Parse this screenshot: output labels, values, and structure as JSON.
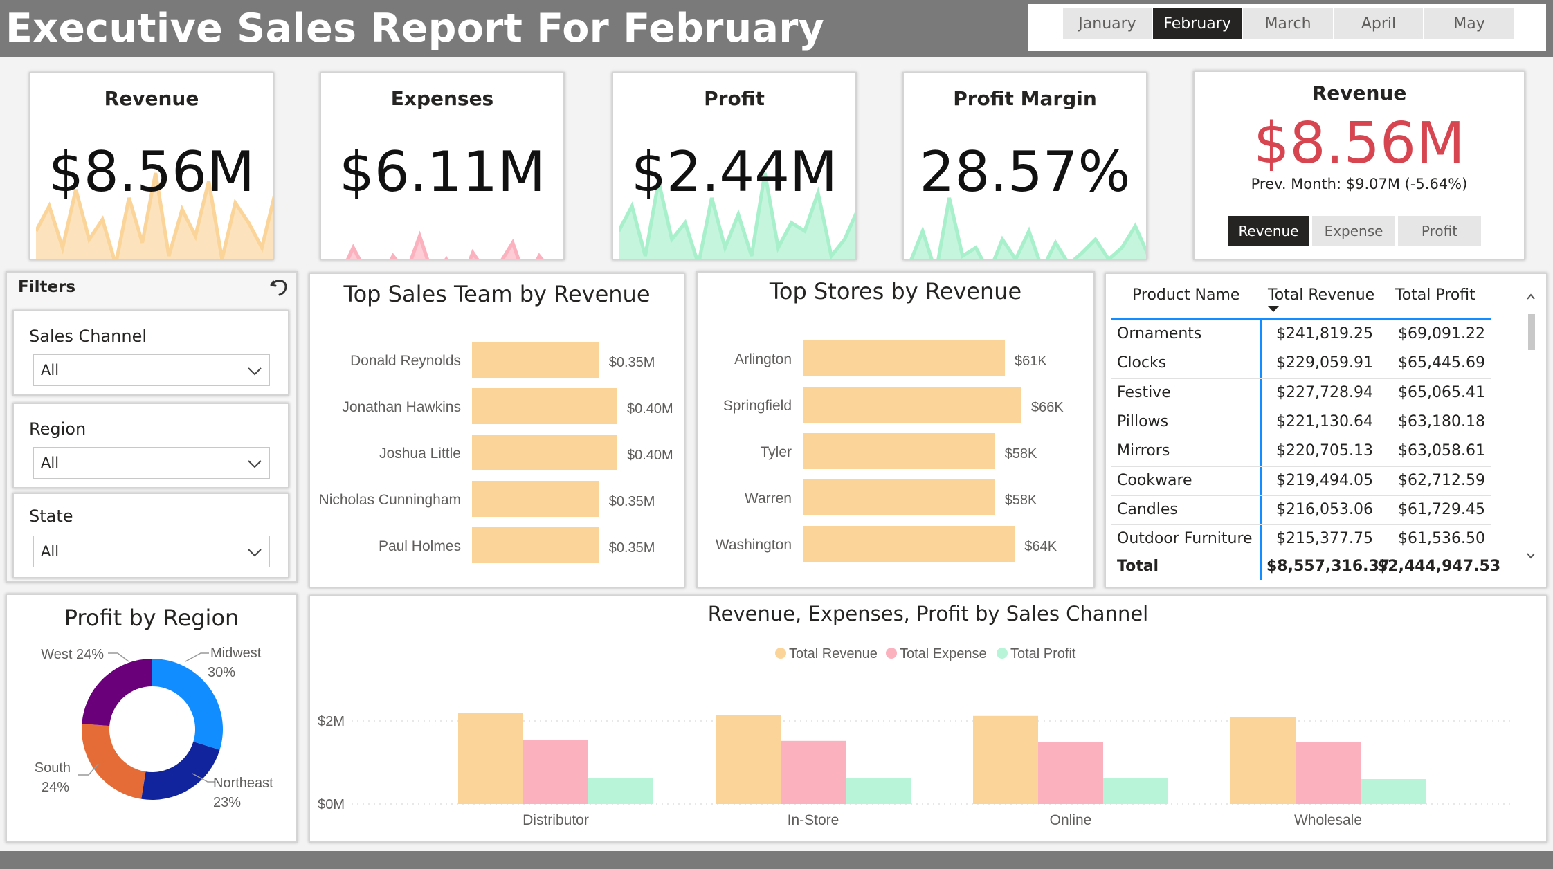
{
  "header": {
    "title": "Executive Sales Report For February",
    "months": [
      "January",
      "February",
      "March",
      "April",
      "May"
    ],
    "selected_month": "February"
  },
  "kpis": [
    {
      "title": "Revenue",
      "value": "$8.56M",
      "color": "#fbd49a"
    },
    {
      "title": "Expenses",
      "value": "$6.11M",
      "color": "#fcb1bf"
    },
    {
      "title": "Profit",
      "value": "$2.44M",
      "color": "#a8f0cb"
    },
    {
      "title": "Profit Margin",
      "value": "28.57%",
      "color": "#a8f0cb"
    }
  ],
  "revenue_card": {
    "title": "Revenue",
    "value": "$8.56M",
    "prev": "Prev. Month: $9.07M (-5.64%)",
    "value_color": "#d64550",
    "toggles": [
      "Revenue",
      "Expense",
      "Profit"
    ],
    "selected": "Revenue"
  },
  "filters": {
    "heading": "Filters",
    "slicers": [
      {
        "label": "Sales Channel",
        "value": "All"
      },
      {
        "label": "Region",
        "value": "All"
      },
      {
        "label": "State",
        "value": "All"
      }
    ]
  },
  "sales_team": {
    "title": "Top Sales Team by Revenue",
    "names": [
      "Donald Reynolds",
      "Jonathan Hawkins",
      "Joshua Little",
      "Nicholas Cunningham",
      "Paul Holmes"
    ],
    "labels": [
      "$0.35M",
      "$0.40M",
      "$0.40M",
      "$0.35M",
      "$0.35M"
    ]
  },
  "stores": {
    "title": "Top Stores by Revenue",
    "names": [
      "Arlington",
      "Springfield",
      "Tyler",
      "Warren",
      "Washington"
    ],
    "labels": [
      "$61K",
      "$66K",
      "$58K",
      "$58K",
      "$64K"
    ]
  },
  "product_table": {
    "headers": [
      "Product Name",
      "Total Revenue",
      "Total Profit"
    ],
    "rows": [
      [
        "Ornaments",
        "$241,819.25",
        "$69,091.22"
      ],
      [
        "Clocks",
        "$229,059.91",
        "$65,445.69"
      ],
      [
        "Festive",
        "$227,728.94",
        "$65,065.41"
      ],
      [
        "Pillows",
        "$221,130.64",
        "$63,180.18"
      ],
      [
        "Mirrors",
        "$220,705.13",
        "$63,058.61"
      ],
      [
        "Cookware",
        "$219,494.05",
        "$62,712.59"
      ],
      [
        "Candles",
        "$216,053.06",
        "$61,729.45"
      ],
      [
        "Outdoor Furniture",
        "$215,377.75",
        "$61,536.50"
      ]
    ],
    "total": [
      "Total",
      "$8,557,316.37",
      "$2,444,947.53"
    ]
  },
  "region": {
    "title": "Profit by Region",
    "labels": [
      {
        "name": "Midwest",
        "pct": "30%"
      },
      {
        "name": "Northeast",
        "pct": "23%"
      },
      {
        "name": "South",
        "pct": "24%"
      },
      {
        "name": "West 24%",
        "pct": ""
      }
    ]
  },
  "channel": {
    "title": "Revenue, Expenses, Profit by Sales Channel",
    "legend": [
      "Total Revenue",
      "Total Expense",
      "Total Profit"
    ],
    "yticks": [
      "$2M",
      "$0M"
    ]
  },
  "chart_data": [
    {
      "type": "bar",
      "title": "Top Sales Team by Revenue",
      "orientation": "horizontal",
      "categories": [
        "Donald Reynolds",
        "Jonathan Hawkins",
        "Joshua Little",
        "Nicholas Cunningham",
        "Paul Holmes"
      ],
      "values": [
        0.35,
        0.4,
        0.4,
        0.35,
        0.35
      ],
      "unit": "$M",
      "color": "#fbd49a"
    },
    {
      "type": "bar",
      "title": "Top Stores by Revenue",
      "orientation": "horizontal",
      "categories": [
        "Arlington",
        "Springfield",
        "Tyler",
        "Warren",
        "Washington"
      ],
      "values": [
        61,
        66,
        58,
        58,
        64
      ],
      "unit": "$K",
      "color": "#fbd49a"
    },
    {
      "type": "pie",
      "title": "Profit by Region",
      "categories": [
        "Midwest",
        "Northeast",
        "South",
        "West"
      ],
      "values": [
        30,
        23,
        24,
        24
      ],
      "colors": [
        "#118dff",
        "#12239e",
        "#e66c37",
        "#6b007b"
      ]
    },
    {
      "type": "bar",
      "title": "Revenue, Expenses, Profit by Sales Channel",
      "categories": [
        "Distributor",
        "In-Store",
        "Online",
        "Wholesale"
      ],
      "series": [
        {
          "name": "Total Revenue",
          "values": [
            2.2,
            2.15,
            2.12,
            2.1
          ],
          "color": "#fbd49a"
        },
        {
          "name": "Total Expense",
          "values": [
            1.55,
            1.52,
            1.5,
            1.5
          ],
          "color": "#fcb1bf"
        },
        {
          "name": "Total Profit",
          "values": [
            0.63,
            0.62,
            0.62,
            0.6
          ],
          "color": "#b8f5d8"
        }
      ],
      "ylim": [
        0,
        2.2
      ],
      "ytick_values": [
        0,
        2
      ]
    },
    {
      "type": "area",
      "title": "Revenue",
      "values": [
        0.55,
        0.7,
        0.45,
        0.8,
        0.5,
        0.62,
        0.35,
        0.75,
        0.48,
        0.9,
        0.4,
        0.68,
        0.52,
        0.85,
        0.38,
        0.72,
        0.6,
        0.45,
        0.78,
        0.55,
        0.66,
        0.42,
        0.88,
        0.5,
        0.62,
        0.7,
        0.58,
        0.45,
        0.8,
        0.52,
        0.4
      ],
      "color": "#fbd49a"
    },
    {
      "type": "area",
      "title": "Expenses",
      "values": [
        0.35,
        0.28,
        0.45,
        0.3,
        0.25,
        0.4,
        0.3,
        0.52,
        0.28,
        0.38,
        0.22,
        0.42,
        0.3,
        0.35,
        0.48,
        0.25,
        0.4,
        0.3,
        0.36,
        0.28,
        0.32,
        0.44,
        0.3,
        0.38,
        0.26,
        0.34,
        0.3,
        0.42,
        0.28,
        0.3,
        0.12
      ],
      "color": "#fcb1bf"
    },
    {
      "type": "area",
      "title": "Profit",
      "values": [
        0.55,
        0.7,
        0.4,
        0.85,
        0.5,
        0.6,
        0.35,
        0.75,
        0.45,
        0.65,
        0.4,
        0.9,
        0.45,
        0.6,
        0.55,
        0.78,
        0.4,
        0.5,
        0.68,
        0.45,
        0.62,
        0.7,
        0.4,
        0.52,
        0.66,
        0.48,
        0.58,
        0.7,
        0.45,
        0.62,
        0.4
      ],
      "color": "#a8f0cb"
    },
    {
      "type": "area",
      "title": "Profit Margin",
      "values": [
        0.35,
        0.55,
        0.3,
        0.75,
        0.4,
        0.45,
        0.3,
        0.5,
        0.38,
        0.55,
        0.32,
        0.48,
        0.35,
        0.42,
        0.5,
        0.38,
        0.45,
        0.58,
        0.4,
        0.5,
        0.65,
        0.42,
        0.5,
        0.38,
        0.55,
        0.45,
        0.4,
        0.52,
        0.38,
        0.48,
        0.45
      ],
      "color": "#a8f0cb"
    }
  ]
}
